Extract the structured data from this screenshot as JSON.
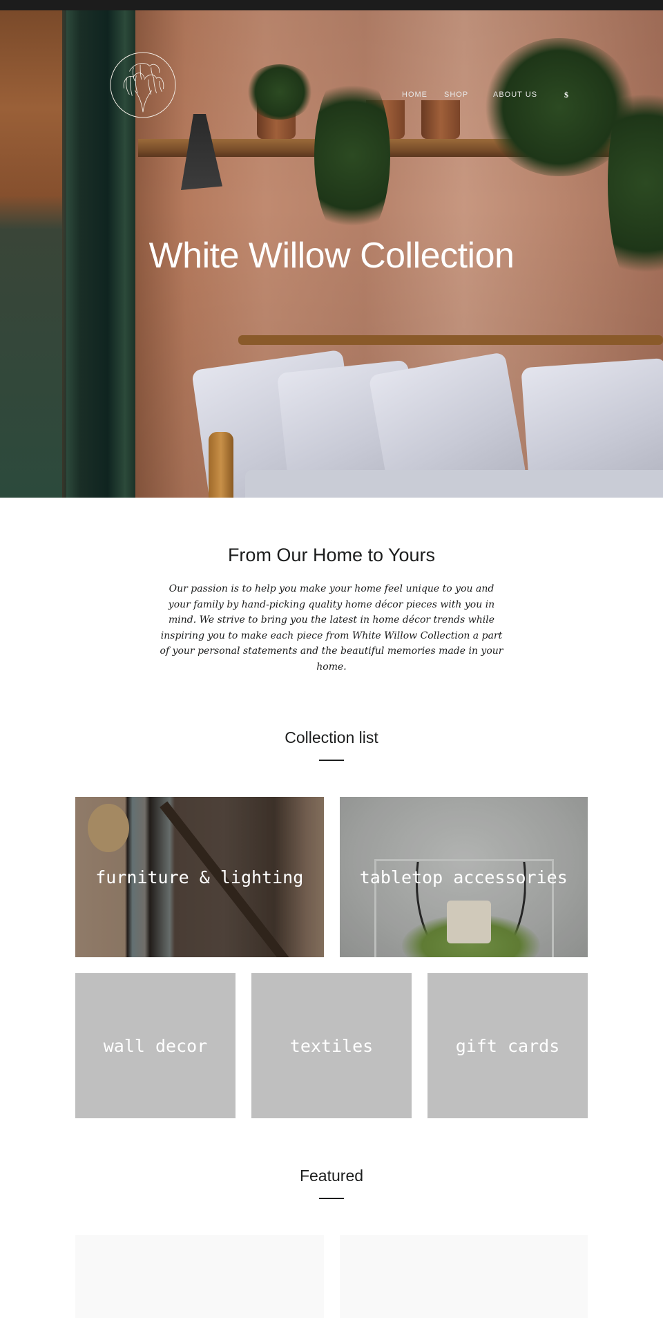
{
  "topbar": {},
  "header": {
    "logo_alt": "White Willow Collection logo",
    "nav": [
      {
        "label": "HOME"
      },
      {
        "label": "SHOP"
      },
      {
        "label": "ABOUT US"
      }
    ],
    "cart_icon_glyph": "$"
  },
  "hero": {
    "title": "White Willow Collection"
  },
  "intro": {
    "heading": "From Our Home to Yours",
    "body": "Our passion is to help you make your home feel unique to you and your family by hand-picking quality home décor pieces with you in mind. We strive to bring you the latest in home décor trends while inspiring you to make each piece from White Willow Collection a part of your personal statements and the beautiful memories made in your home."
  },
  "collection_list": {
    "heading": "Collection list",
    "items": [
      {
        "label": "furniture & lighting"
      },
      {
        "label": "tabletop accessories"
      },
      {
        "label": "wall decor"
      },
      {
        "label": "textiles"
      },
      {
        "label": "gift cards"
      }
    ]
  },
  "featured": {
    "heading": "Featured"
  },
  "colors": {
    "topbar": "#1c1c1c",
    "text": "#1c1d1d",
    "placeholder_tile": "#bfbfbf",
    "featured_card": "#f9f9f9"
  }
}
